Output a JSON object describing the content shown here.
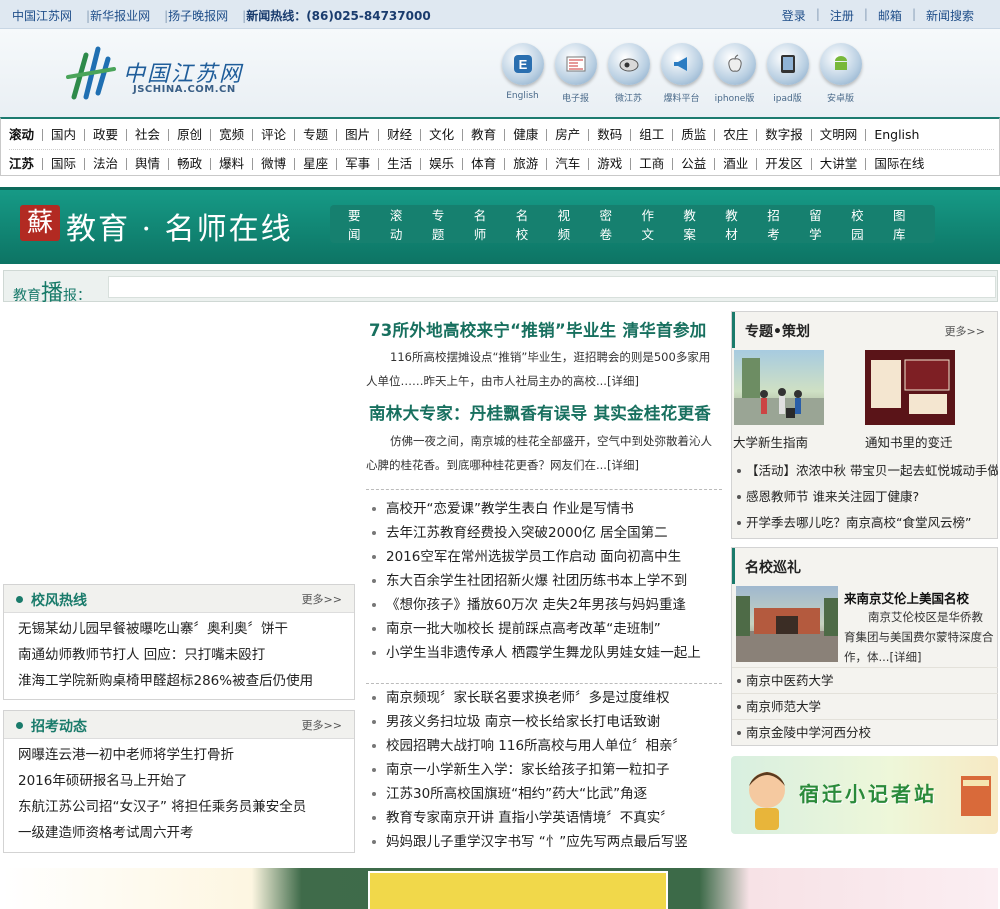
{
  "topbar": {
    "links": [
      "中国江苏网",
      "新华报业网",
      "扬子晚报网"
    ],
    "hotline": "新闻热线：(86)025-84737000",
    "right_links": [
      "登录",
      "注册",
      "邮箱",
      "新闻搜索"
    ]
  },
  "header": {
    "logo_cn": "中国江苏网",
    "logo_en": "JSCHINA.COM.CN",
    "apps": [
      {
        "label": "English",
        "icon": "english-icon"
      },
      {
        "label": "电子报",
        "icon": "newspaper-icon"
      },
      {
        "label": "微江苏",
        "icon": "weibo-icon"
      },
      {
        "label": "爆料平台",
        "icon": "megaphone-icon"
      },
      {
        "label": "iphone版",
        "icon": "apple-icon"
      },
      {
        "label": "ipad版",
        "icon": "ipad-icon"
      },
      {
        "label": "安卓版",
        "icon": "android-icon"
      }
    ]
  },
  "nav": {
    "row1": [
      "滚动",
      "国内",
      "政要",
      "社会",
      "原创",
      "宽频",
      "评论",
      "专题",
      "图片",
      "财经",
      "文化",
      "教育",
      "健康",
      "房产",
      "数码",
      "组工",
      "质监",
      "农庄",
      "数字报",
      "文明网",
      "English"
    ],
    "row2": [
      "江苏",
      "国际",
      "法治",
      "舆情",
      "畅政",
      "爆料",
      "微博",
      "星座",
      "军事",
      "生活",
      "娱乐",
      "体育",
      "旅游",
      "汽车",
      "游戏",
      "工商",
      "公益",
      "酒业",
      "开发区",
      "大讲堂",
      "国际在线"
    ]
  },
  "channel": {
    "badge": "蘇",
    "title": "教育 · 名师在线",
    "menu": [
      "要闻",
      "滚动",
      "专题",
      "名师",
      "名校",
      "视频",
      "密卷",
      "作文",
      "教案",
      "教材",
      "招考",
      "留学",
      "校园",
      "图库"
    ]
  },
  "broadcast": {
    "prefix": "教育",
    "big": "播",
    "suffix": "报："
  },
  "headlines": [
    {
      "title": "73所外地高校来宁“推销”毕业生  清华首参加",
      "summary": "116所高校摆摊设点“推销”毕业生，逛招聘会的则是500多家用人单位……昨天上午，由市人社局主办的高校...[详细]"
    },
    {
      "title": "南林大专家：丹桂飘香有误导  其实金桂花更香",
      "summary": "仿佛一夜之间，南京城的桂花全部盛开，空气中到处弥散着沁人心脾的桂花香。到底哪种桂花更香？网友们在...[详细]"
    }
  ],
  "news1": [
    "高校开“恋爱课”教学生表白  作业是写情书",
    "去年江苏教育经费投入突破2000亿  居全国第二",
    "2016空军在常州选拔学员工作启动  面向初高中生",
    "东大百余学生社团招新火爆  社团历练书本上学不到",
    "《想你孩子》播放60万次  走失2年男孩与妈妈重逢",
    "南京一批大咖校长  提前踩点高考改革“走班制”",
    "小学生当非遗传承人  栖霞学生舞龙队男娃女娃一起上"
  ],
  "news2": [
    "南京频现〞家长联名要求换老师〞多是过度维权",
    "男孩义务扫垃圾  南京一校长给家长打电话致谢",
    "校园招聘大战打响  116所高校与用人单位〞相亲〞",
    "南京一小学新生入学：家长给孩子扣第一粒扣子",
    "江苏30所高校国旗班“相约”药大“比武”角逐",
    "教育专家南京开讲  直指小学英语情境〞不真实〞",
    "妈妈跟儿子重学汉字书写  “忄”应先写两点最后写竖"
  ],
  "left_boxes": [
    {
      "title": "校风热线",
      "more": "更多>>",
      "items": [
        "无锡某幼儿园早餐被曝吃山寨〞奥利奥〞饼干",
        "南通幼师教师节打人  回应：只打嘴未殴打",
        "淮海工学院新购桌椅甲醛超标286%被查后仍使用"
      ]
    },
    {
      "title": "招考动态",
      "more": "更多>>",
      "items": [
        "网曝连云港一初中老师将学生打骨折",
        "2016年硕研报名马上开始了",
        "东航江苏公司招“女汉子”  将担任乘务员兼安全员",
        "一级建造师资格考试周六开考"
      ]
    }
  ],
  "special": {
    "title": "专题•策划",
    "more": "更多>>",
    "captions": [
      "大学新生指南",
      "通知书里的变迁"
    ],
    "items": [
      "【活动】浓浓中秋  带宝贝一起去虹悦城动手做",
      "感恩教师节  谁来关注园丁健康?",
      "开学季去哪儿吃？南京高校“食堂风云榜”"
    ]
  },
  "tour": {
    "title": "名校巡礼",
    "feature_title": "来南京艾伦上美国名校",
    "feature_summary": "南京艾伦校区是华侨教育集团与美国费尔蒙特深度合作，体...[详细]",
    "items": [
      "南京中医药大学",
      "南京师范大学",
      "南京金陵中学河西分校"
    ]
  },
  "reporter": {
    "text": "宿迁小记者站"
  }
}
